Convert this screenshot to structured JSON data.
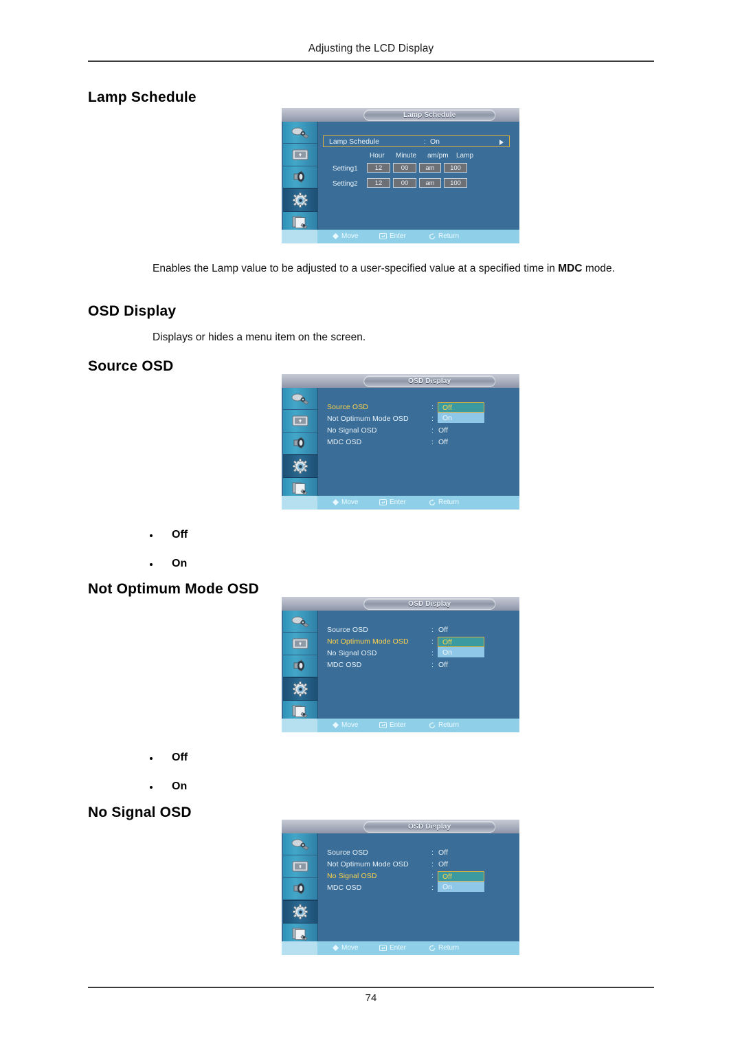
{
  "document": {
    "running_header": "Adjusting the LCD Display",
    "page_number": "74"
  },
  "sections": [
    {
      "id": "lamp_schedule",
      "heading": "Lamp Schedule",
      "body_text": "Enables the Lamp value to be adjusted to a user-specified value at a specified time in MDC mode."
    },
    {
      "id": "osd_display",
      "heading": "OSD Display",
      "body_text": "Displays or hides a menu item on the screen."
    },
    {
      "id": "source_osd",
      "heading": "Source OSD"
    },
    {
      "id": "not_optimum_mode_osd",
      "heading": "Not Optimum Mode OSD"
    },
    {
      "id": "no_signal_osd",
      "heading": "No Signal OSD"
    }
  ],
  "bullet_options": [
    "Off",
    "On"
  ],
  "osd_common": {
    "nav": {
      "move": "Move",
      "enter": "Enter",
      "return": "Return"
    },
    "sidebar_icons": [
      "picture-icon",
      "screen-icon",
      "sound-icon",
      "setup-gear-icon",
      "multi-control-icon"
    ],
    "colors": {
      "panel_bg": "#3a6e98",
      "sidebar": "#2e92b8",
      "highlight_border": "#e0b23c",
      "highlight_text": "#ffd24a",
      "nav_bar": "#8fd0e8",
      "selected_option_bg": "#3b9aa0",
      "alt_option_bg": "#8fc7e8"
    }
  },
  "osd_lamp_schedule": {
    "title": "Lamp Schedule",
    "row": {
      "label": "Lamp Schedule",
      "colon": ":",
      "value": "On"
    },
    "table": {
      "headers": [
        "Hour",
        "Minute",
        "am/pm",
        "Lamp"
      ],
      "rows": [
        {
          "label": "Setting1",
          "values": [
            "12",
            "00",
            "am",
            "100"
          ]
        },
        {
          "label": "Setting2",
          "values": [
            "12",
            "00",
            "am",
            "100"
          ]
        }
      ]
    }
  },
  "osd_source": {
    "title": "OSD Display",
    "rows": [
      {
        "label": "Source OSD",
        "colon": ":",
        "value": "Off",
        "active": true
      },
      {
        "label": "Not Optimum Mode OSD",
        "colon": ":",
        "value": "On",
        "active": false
      },
      {
        "label": "No Signal OSD",
        "colon": ":",
        "value": "Off",
        "active": false
      },
      {
        "label": "MDC OSD",
        "colon": ":",
        "value": "Off",
        "active": false
      }
    ],
    "dropdown": {
      "selected": "Off",
      "other": "On",
      "attached_row": 0
    }
  },
  "osd_not_optimum": {
    "title": "OSD Display",
    "rows": [
      {
        "label": "Source OSD",
        "colon": ":",
        "value": "Off",
        "active": false
      },
      {
        "label": "Not Optimum Mode OSD",
        "colon": ":",
        "value": "Off",
        "active": true
      },
      {
        "label": "No Signal OSD",
        "colon": ":",
        "value": "On",
        "active": false
      },
      {
        "label": "MDC OSD",
        "colon": ":",
        "value": "Off",
        "active": false
      }
    ],
    "dropdown": {
      "selected": "Off",
      "other": "On",
      "attached_row": 1
    }
  },
  "osd_no_signal": {
    "title": "OSD Display",
    "rows": [
      {
        "label": "Source OSD",
        "colon": ":",
        "value": "Off",
        "active": false
      },
      {
        "label": "Not Optimum Mode OSD",
        "colon": ":",
        "value": "Off",
        "active": false
      },
      {
        "label": "No Signal OSD",
        "colon": ":",
        "value": "Off",
        "active": true
      },
      {
        "label": "MDC OSD",
        "colon": ":",
        "value": "On",
        "active": false
      }
    ],
    "dropdown": {
      "selected": "Off",
      "other": "On",
      "attached_row": 2
    }
  }
}
